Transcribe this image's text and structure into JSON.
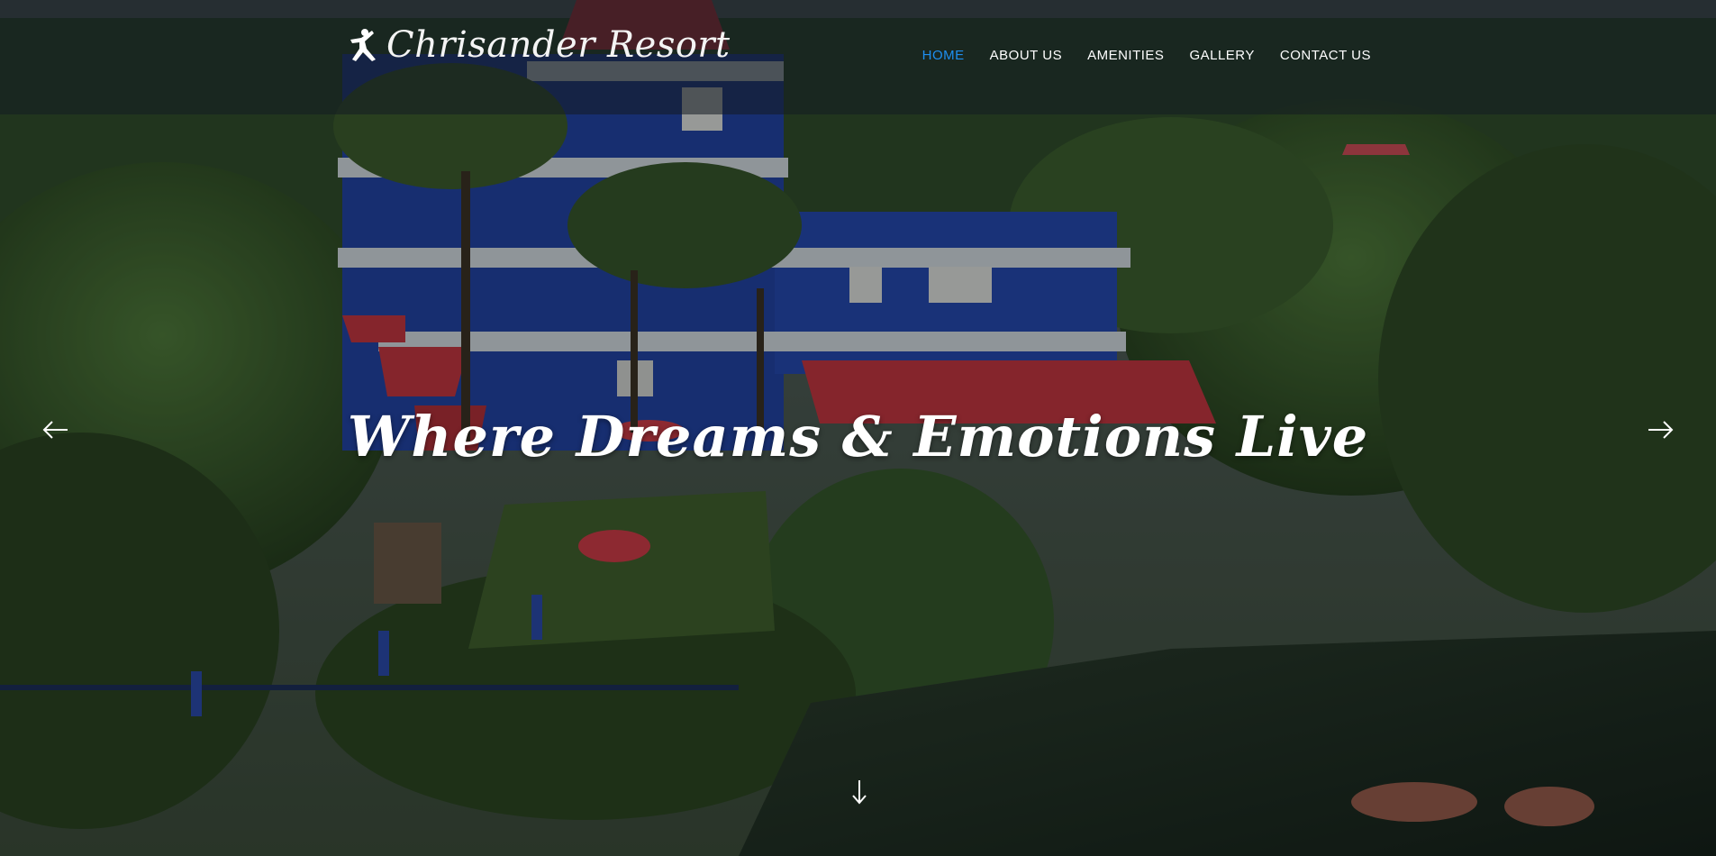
{
  "brand": {
    "name": "Chrisander Resort",
    "icon": "leaping-figure-logo-icon"
  },
  "nav": {
    "items": [
      {
        "label": "HOME",
        "active": true
      },
      {
        "label": "ABOUT US",
        "active": false
      },
      {
        "label": "AMENITIES",
        "active": false
      },
      {
        "label": "GALLERY",
        "active": false
      },
      {
        "label": "CONTACT US",
        "active": false
      }
    ],
    "active_color": "#1e8ff0",
    "text_color": "#ffffff"
  },
  "hero": {
    "headline": "Where Dreams & Emotions Live",
    "prev_icon": "arrow-left-icon",
    "next_icon": "arrow-right-icon",
    "scroll_icon": "arrow-down-icon"
  },
  "colors": {
    "building_blue": "#1f3fa8",
    "roof_red": "#c8323f",
    "foliage": "#2e4a22",
    "water": "#1d2a24"
  }
}
